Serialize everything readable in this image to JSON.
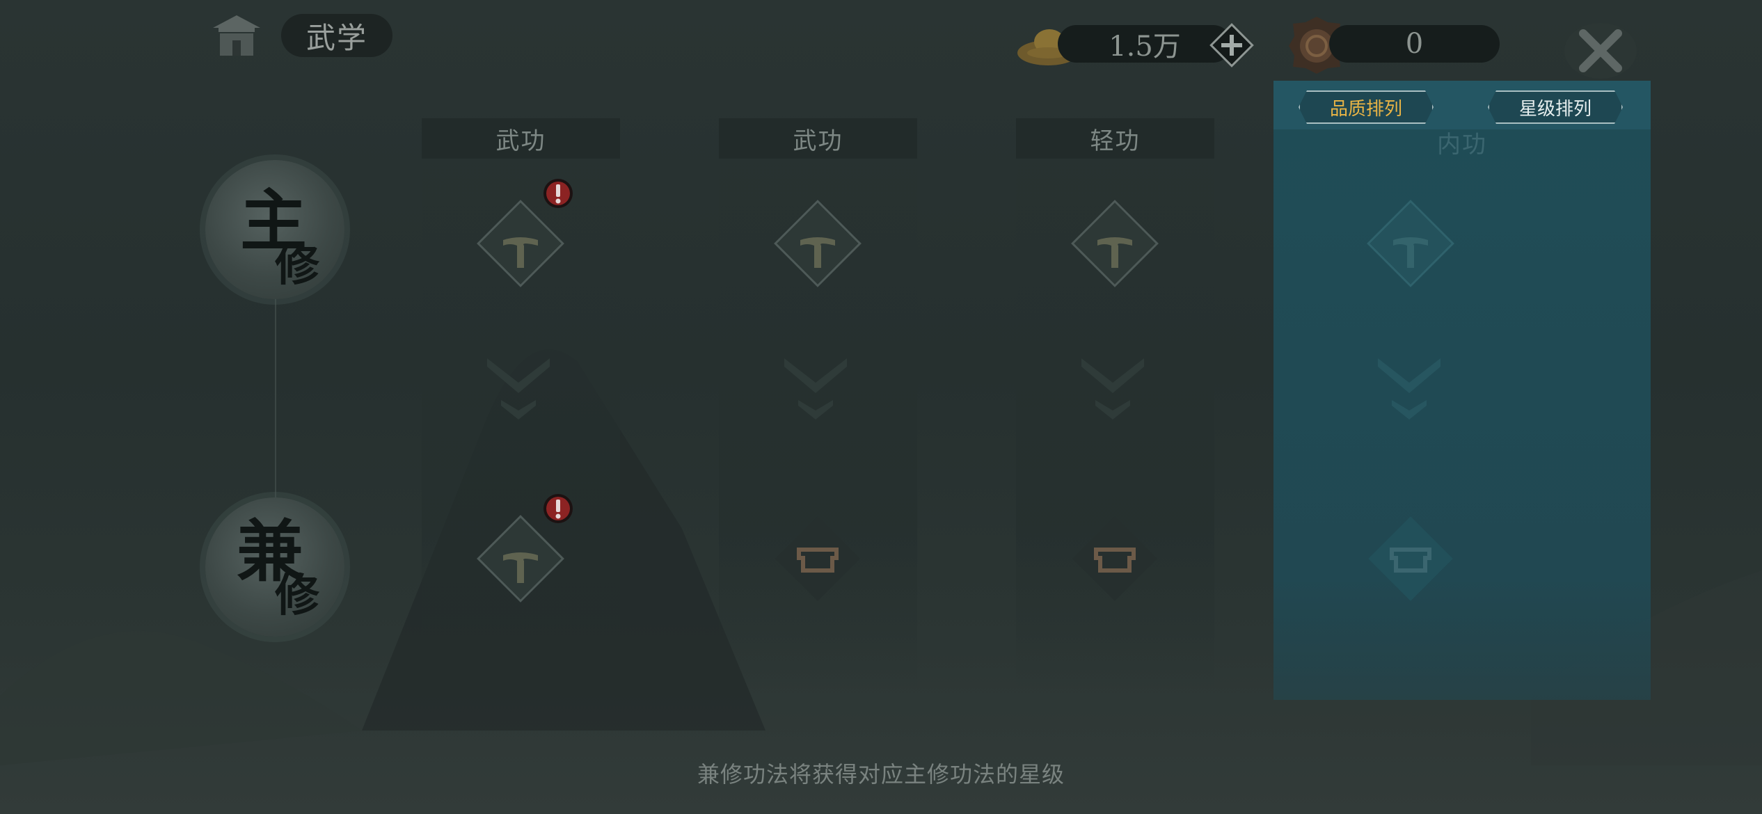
{
  "header": {
    "title": "武学",
    "gold_amount": "1.5万",
    "medal_amount": "0"
  },
  "sort": {
    "quality": "品质排列",
    "star": "星级排列"
  },
  "left": {
    "main_big": "主",
    "main_small": "修",
    "sub_big": "兼",
    "sub_small": "修"
  },
  "columns": [
    {
      "label": "武功"
    },
    {
      "label": "武功"
    },
    {
      "label": "轻功"
    },
    {
      "label": "内功"
    }
  ],
  "footer": {
    "hint": "兼修功法将获得对应主修功法的星级"
  },
  "colors": {
    "accent": "#e9b445",
    "panel": "#1f4d57",
    "alert": "#b32a2a"
  }
}
